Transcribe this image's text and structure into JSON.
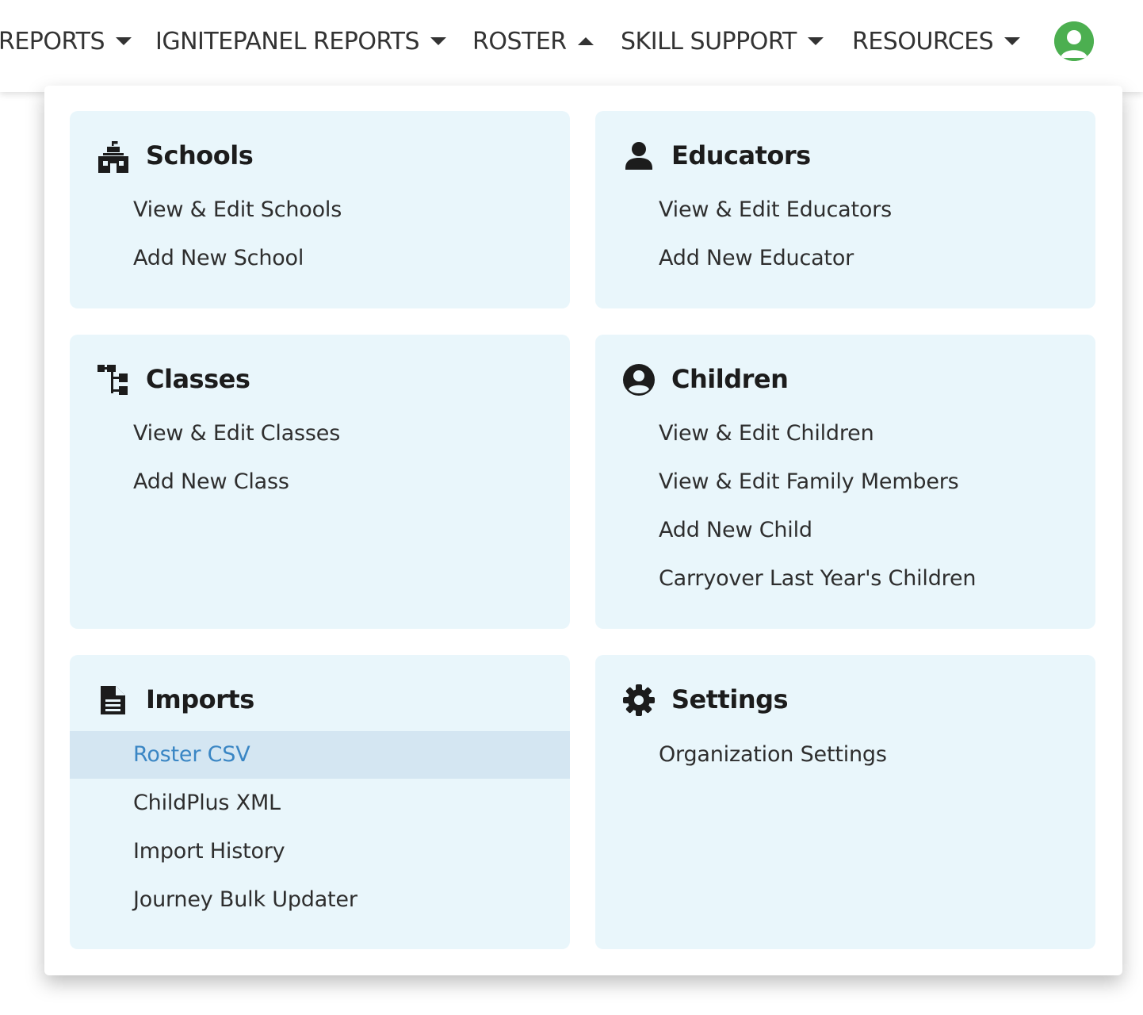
{
  "nav": {
    "items": [
      {
        "label": "REPORTS",
        "caret": "down"
      },
      {
        "label": "IGNITEPANEL REPORTS",
        "caret": "down"
      },
      {
        "label": "ROSTER",
        "caret": "up"
      },
      {
        "label": "SKILL SUPPORT",
        "caret": "down"
      },
      {
        "label": "RESOURCES",
        "caret": "down"
      }
    ],
    "avatar_icon": "user-avatar-icon",
    "avatar_color": "#4caf50"
  },
  "menu": {
    "schools": {
      "title": "Schools",
      "icon": "school-building-icon",
      "links": [
        "View & Edit Schools",
        "Add New School"
      ]
    },
    "educators": {
      "title": "Educators",
      "icon": "person-icon",
      "links": [
        "View & Edit Educators",
        "Add New Educator"
      ]
    },
    "classes": {
      "title": "Classes",
      "icon": "hierarchy-icon",
      "links": [
        "View & Edit Classes",
        "Add New Class"
      ]
    },
    "children": {
      "title": "Children",
      "icon": "user-circle-icon",
      "links": [
        "View & Edit Children",
        "View & Edit Family Members",
        "Add New Child",
        "Carryover Last Year's Children"
      ]
    },
    "imports": {
      "title": "Imports",
      "icon": "file-document-icon",
      "links": [
        "Roster CSV",
        "ChildPlus XML",
        "Import History",
        "Journey Bulk Updater"
      ],
      "active_link": "Roster CSV"
    },
    "settings": {
      "title": "Settings",
      "icon": "gear-icon",
      "links": [
        "Organization Settings"
      ]
    }
  },
  "colors": {
    "card_background": "#e9f6fb",
    "active_background": "#d4e6f2",
    "active_text": "#3a86c4",
    "text": "#2e2e2e"
  }
}
